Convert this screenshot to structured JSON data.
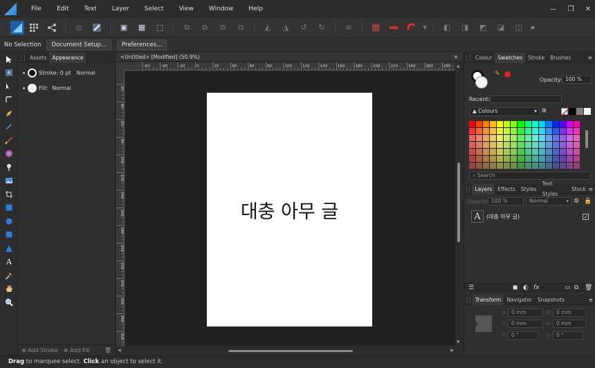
{
  "menu": [
    "File",
    "Edit",
    "Text",
    "Layer",
    "Select",
    "View",
    "Window",
    "Help"
  ],
  "window_controls": {
    "minimize": "—",
    "restore": "❐",
    "close": "✕"
  },
  "context_bar": {
    "selection": "No Selection",
    "document_setup": "Document Setup...",
    "preferences": "Preferences..."
  },
  "left_panel": {
    "tabs": [
      "Assets",
      "Appearance"
    ],
    "active_tab": "Appearance",
    "stroke_label": "Stroke: 0 pt",
    "stroke_blend": "Normal",
    "fill_label": "Fill:",
    "fill_blend": "Normal",
    "add_stroke": "Add Stroke",
    "add_fill": "Add Fill"
  },
  "document": {
    "tab_title": "<Untitled> [Modified] (50.9%)",
    "close": "✕",
    "artboard_text": "대충 아무 글",
    "ruler_h_labels": [
      "-60",
      "-40",
      "-20",
      "0",
      "20",
      "40",
      "60",
      "80",
      "100",
      "120",
      "140",
      "160",
      "180",
      "200",
      "220",
      "240",
      "260",
      "280",
      "300"
    ],
    "ruler_v_labels": [
      "20",
      "40",
      "60",
      "80",
      "100",
      "120",
      "140",
      "160",
      "180",
      "200",
      "220",
      "240",
      "260",
      "280",
      "300"
    ]
  },
  "swatches_panel": {
    "tabs": [
      "Colour",
      "Swatches",
      "Stroke",
      "Brushes"
    ],
    "active_tab": "Swatches",
    "opacity_label": "Opacity:",
    "opacity_value": "100 %",
    "recent_label": "Recent:",
    "palette_name": "Colours",
    "search_placeholder": "Search"
  },
  "layers_panel": {
    "tabs": [
      "Layers",
      "Effects",
      "Styles",
      "Text Styles",
      "Stock"
    ],
    "active_tab": "Layers",
    "opacity_label": "Opacity",
    "opacity_value": "100 %",
    "blend_mode": "Normal",
    "layer_name": "(대충 아무 글)",
    "layer_thumb_glyph": "A"
  },
  "transform_panel": {
    "tabs": [
      "Transform",
      "Navigator",
      "Snapshots"
    ],
    "active_tab": "Transform",
    "x_label": "X:",
    "x_value": "0 mm",
    "y_label": "Y:",
    "y_value": "0 mm",
    "w_label": "W:",
    "w_value": "0 mm",
    "h_label": "H:",
    "h_value": "0 mm",
    "r_label": "R:",
    "r_value": "0 °",
    "s_label": "S:",
    "s_value": "0 °"
  },
  "status": {
    "drag": "Drag",
    "drag_text": " to marquee select. ",
    "click": "Click",
    "click_text": " an object to select it."
  },
  "colors": {
    "accent": "#2a7fd4",
    "swatch_red": "#e02020"
  }
}
